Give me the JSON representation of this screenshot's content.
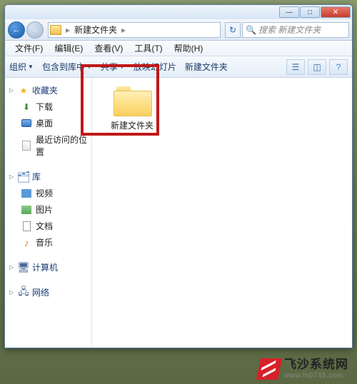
{
  "titlebar": {
    "min": "—",
    "max": "□",
    "close": "✕"
  },
  "nav": {
    "back": "←",
    "forward": "→",
    "refresh": "↻"
  },
  "address": {
    "seg1": "新建文件夹",
    "sep": "▸"
  },
  "search": {
    "placeholder": "搜索 新建文件夹",
    "icon": "🔍"
  },
  "menu": {
    "file": "文件(F)",
    "edit": "编辑(E)",
    "view": "查看(V)",
    "tools": "工具(T)",
    "help": "帮助(H)"
  },
  "toolbar": {
    "organize": "组织",
    "include": "包含到库中",
    "share": "共享",
    "slideshow": "放映幻灯片",
    "newfolder": "新建文件夹"
  },
  "sidebar": {
    "fav": {
      "head": "收藏夹",
      "items": [
        "下载",
        "桌面",
        "最近访问的位置"
      ]
    },
    "lib": {
      "head": "库",
      "items": [
        "视频",
        "图片",
        "文档",
        "音乐"
      ]
    },
    "pc": {
      "head": "计算机"
    },
    "net": {
      "head": "网络"
    }
  },
  "content": {
    "folder1_label": "新建文件夹"
  },
  "watermark": {
    "main": "飞沙系统网",
    "sub": "www.fs0745.com"
  }
}
